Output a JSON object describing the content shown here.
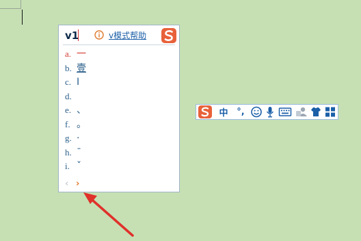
{
  "document": {},
  "candidate_window": {
    "input_text": "v1",
    "help_link": "v模式帮助",
    "candidates": [
      {
        "key": "a.",
        "char": "一"
      },
      {
        "key": "b.",
        "char": "壹"
      },
      {
        "key": "c.",
        "char": "Ⅰ"
      },
      {
        "key": "d.",
        "char": ""
      },
      {
        "key": "e.",
        "char": "、"
      },
      {
        "key": "f.",
        "char": "。"
      },
      {
        "key": "g.",
        "char": "·"
      },
      {
        "key": "h.",
        "char": "ˉ"
      },
      {
        "key": "i.",
        "char": "ˇ"
      }
    ],
    "pager": {
      "prev": "‹",
      "next": "›"
    }
  },
  "ime_toolbar": {
    "mode_label": "中",
    "punct_label": "°,",
    "icons": [
      "sogou-logo",
      "emoji-icon",
      "microphone-icon",
      "keyboard-icon",
      "user-icon",
      "skin-icon",
      "toolbox-icon"
    ]
  },
  "colors": {
    "background": "#c6e0b4",
    "accent_orange": "#e8613a",
    "candidate_blue": "#2a5e8a",
    "first_candidate_red": "#d23a2f",
    "toolbar_blue": "#1a5fa8",
    "annotation_arrow": "#e0312b"
  }
}
